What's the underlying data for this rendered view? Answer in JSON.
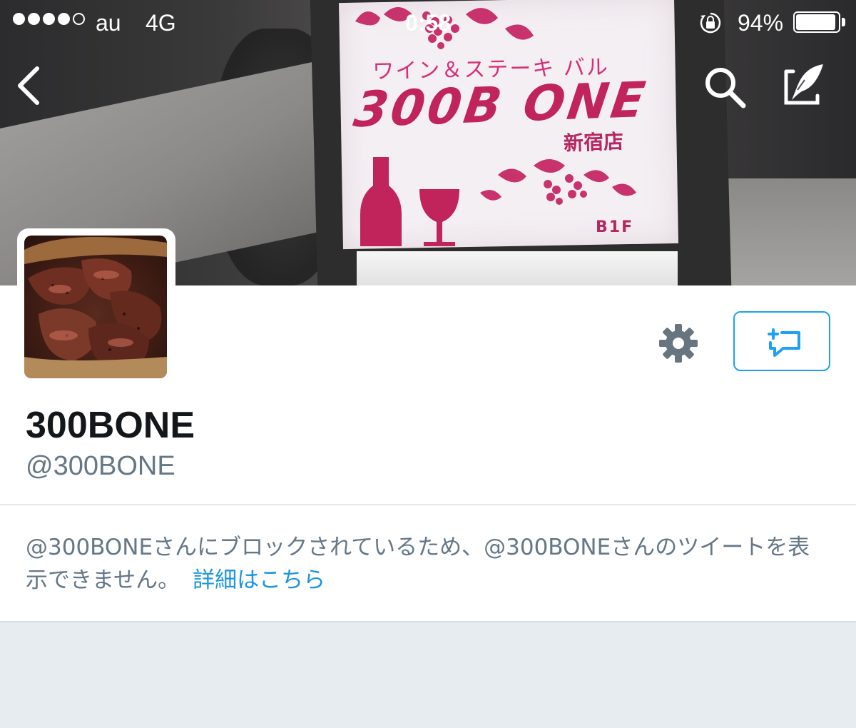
{
  "status_bar": {
    "carrier": "au",
    "network": "4G",
    "time": "0:58",
    "battery_percent": "94%",
    "battery_level": 0.94,
    "signal_bars_filled": 4,
    "signal_bars_total": 5
  },
  "nav": {
    "back_icon": "chevron-left",
    "search_icon": "magnifier",
    "compose_icon": "quill-compose"
  },
  "banner": {
    "sign_line1": "ワイン＆ステーキ バル",
    "sign_logo": "300B ONE",
    "sign_branch": "新宿店",
    "sign_floor": "B1F"
  },
  "profile": {
    "display_name": "300BONE",
    "handle": "@300BONE",
    "settings_icon": "gear",
    "message_icon": "new-direct-message"
  },
  "notice": {
    "text": "@300BONEさんにブロックされているため、@300BONEさんのツイートを表示できません。",
    "link_label": "詳細はこちら"
  },
  "colors": {
    "accent": "#1da1f2",
    "link": "#1b95e0",
    "secondary_text": "#657786",
    "primary_text": "#14171a",
    "background": "#e6ecf0"
  }
}
